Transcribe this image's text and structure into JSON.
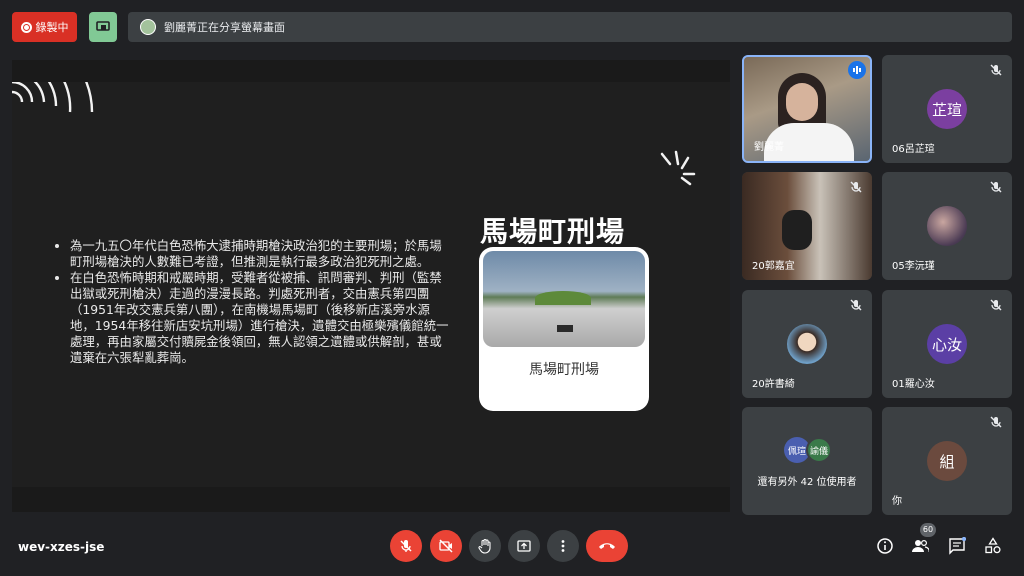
{
  "topbar": {
    "record_label": "錄製中",
    "share_banner": "劉麗菁正在分享螢幕畫面"
  },
  "slide": {
    "title": "馬場町刑場",
    "bullets": [
      "為一九五〇年代白色恐怖大逮捕時期槍決政治犯的主要刑場；於馬場町刑場槍決的人數難已考證，但推測是執行最多政治犯死刑之處。",
      "在白色恐怖時期和戒嚴時期，受難者從被捕、訊問審判、判刑（監禁出獄或死刑槍決）走過的漫漫長路。判處死刑者，交由憲兵第四團（1951年改交憲兵第八團），在南機場馬場町（後移新店溪旁水源地，1954年移往新店安坑刑場）進行槍決，遺體交由極樂殯儀館統一處理，再由家屬交付贖屍金後領回，無人認領之遺體或供解剖，甚或遺棄在六張犁亂葬崗。"
    ],
    "photo_caption": "馬場町刑場"
  },
  "participants": [
    {
      "name": "劉麗菁",
      "type": "video",
      "speaking": true
    },
    {
      "name": "06呂芷瑄",
      "type": "avatar",
      "initials": "芷瑄",
      "color": "#7b3fa0"
    },
    {
      "name": "20郭嘉宜",
      "type": "video"
    },
    {
      "name": "05李沅瑾",
      "type": "picture"
    },
    {
      "name": "20許書綺",
      "type": "picture"
    },
    {
      "name": "01羅心汝",
      "type": "avatar",
      "initials": "心汝",
      "color": "#5b3fa5"
    },
    {
      "name": "還有另外 42 位使用者",
      "type": "group",
      "initials_a": "佩瑄",
      "initials_b": "諭儀"
    },
    {
      "name": "你",
      "type": "avatar",
      "initials": "組",
      "color": "#6b4a3e"
    }
  ],
  "bottombar": {
    "meeting_code": "wev-xzes-jse",
    "participant_count": "60"
  },
  "icons": [
    "record-icon",
    "present-icon",
    "mic-off-icon",
    "cam-off-icon",
    "raise-hand-icon",
    "present-now-icon",
    "more-icon",
    "hangup-icon",
    "info-icon",
    "people-icon",
    "chat-icon",
    "activities-icon"
  ]
}
